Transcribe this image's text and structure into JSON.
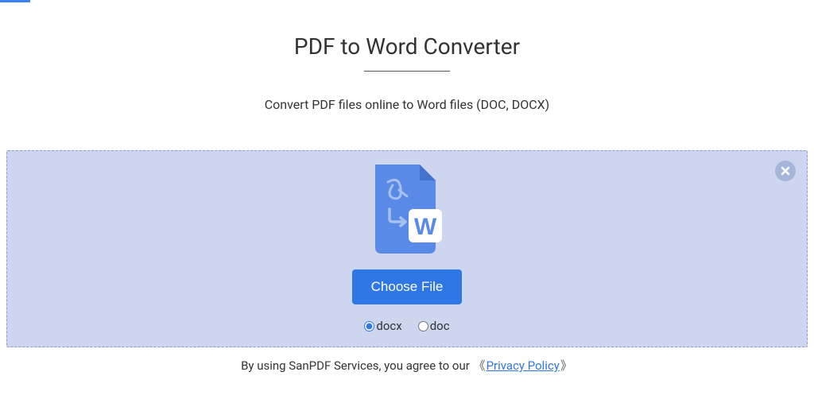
{
  "header": {
    "title": "PDF to Word Converter",
    "subtitle": "Convert PDF files online to Word files (DOC, DOCX)"
  },
  "upload": {
    "choose_file_label": "Choose File",
    "format_options": {
      "docx": "docx",
      "doc": "doc",
      "selected": "docx"
    }
  },
  "footer": {
    "prefix": "By using SanPDF Services, you agree to our ",
    "bracket_open": "《",
    "privacy_label": "Privacy Policy",
    "bracket_close": "》"
  },
  "icons": {
    "close": "close-icon",
    "file_convert": "pdf-to-word-icon"
  },
  "colors": {
    "accent": "#2f77e6",
    "upload_bg": "#cdd6ee",
    "upload_border": "#8b9cc9"
  }
}
